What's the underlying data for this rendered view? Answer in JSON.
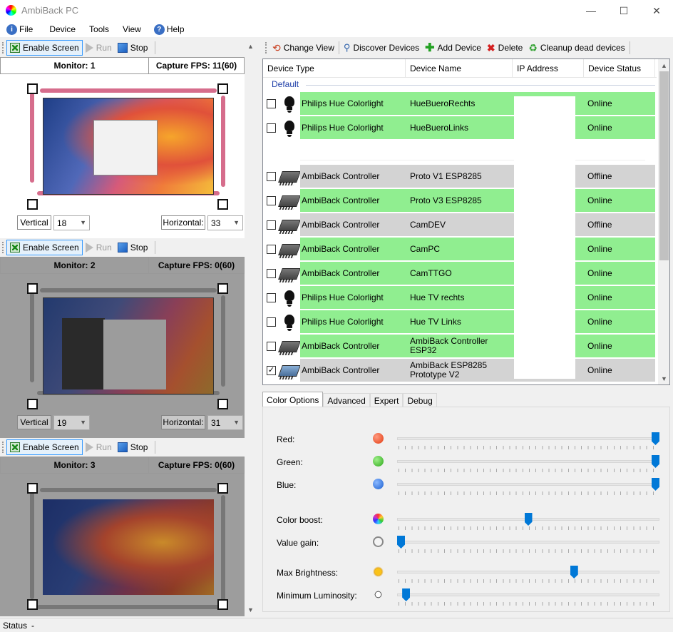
{
  "window": {
    "title": "AmbiBack PC",
    "controls": {
      "minimize": "—",
      "maximize": "☐",
      "close": "✕"
    }
  },
  "menu": [
    "File",
    "Device",
    "Tools",
    "View",
    "Help"
  ],
  "monitors": [
    {
      "toolbar": {
        "enable": "Enable Screen",
        "run": "Run",
        "stop": "Stop"
      },
      "name": "Monitor: 1",
      "fps": "Capture FPS: 11(60)",
      "vertical_label": "Vertical",
      "vertical_value": "18",
      "horizontal_label": "Horizontal:",
      "horizontal_value": "33",
      "active": true
    },
    {
      "toolbar": {
        "enable": "Enable Screen",
        "run": "Run",
        "stop": "Stop"
      },
      "name": "Monitor: 2",
      "fps": "Capture FPS: 0(60)",
      "vertical_label": "Vertical",
      "vertical_value": "19",
      "horizontal_label": "Horizontal:",
      "horizontal_value": "31",
      "active": false
    },
    {
      "toolbar": {
        "enable": "Enable Screen",
        "run": "Run",
        "stop": "Stop"
      },
      "name": "Monitor: 3",
      "fps": "Capture FPS: 0(60)",
      "active": false
    }
  ],
  "device_toolbar": [
    "Change View",
    "Discover Devices",
    "Add Device",
    "Delete",
    "Cleanup dead devices"
  ],
  "table": {
    "columns": [
      "Device Type",
      "Device Name",
      "IP Address",
      "Device Status"
    ],
    "group": "Default",
    "rows": [
      {
        "type": "Philips Hue Colorlight",
        "name": "HueBueroRechts",
        "status": "Online",
        "icon": "bulb-icon",
        "color": "green",
        "checked": false
      },
      {
        "type": "Philips Hue Colorlight",
        "name": "HueBueroLinks",
        "status": "Online",
        "icon": "bulb-icon",
        "color": "green",
        "checked": false
      },
      {
        "type": "",
        "name": "",
        "status": "",
        "icon": "none",
        "color": "white",
        "checked": false
      },
      {
        "type": "AmbiBack Controller",
        "name": "Proto V1 ESP8285",
        "status": "Offline",
        "icon": "controller-icon",
        "color": "grey",
        "checked": false
      },
      {
        "type": "AmbiBack Controller",
        "name": "Proto V3 ESP8285",
        "status": "Online",
        "icon": "controller-icon",
        "color": "green",
        "checked": false
      },
      {
        "type": "AmbiBack Controller",
        "name": "CamDEV",
        "status": "Offline",
        "icon": "controller-icon",
        "color": "grey",
        "checked": false
      },
      {
        "type": "AmbiBack Controller",
        "name": "CamPC",
        "status": "Online",
        "icon": "controller-icon",
        "color": "green",
        "checked": false
      },
      {
        "type": "AmbiBack Controller",
        "name": "CamTTGO",
        "status": "Online",
        "icon": "controller-icon",
        "color": "green",
        "checked": false
      },
      {
        "type": "Philips Hue Colorlight",
        "name": "Hue TV rechts",
        "status": "Online",
        "icon": "bulb-icon",
        "color": "green",
        "checked": false
      },
      {
        "type": "Philips Hue Colorlight",
        "name": "Hue TV Links",
        "status": "Online",
        "icon": "bulb-icon",
        "color": "green",
        "checked": false
      },
      {
        "type": "AmbiBack Controller",
        "name": "AmbiBack Controller ESP32",
        "status": "Online",
        "icon": "controller-icon",
        "color": "green",
        "checked": false
      },
      {
        "type": "AmbiBack Controller",
        "name": "AmbiBack ESP8285 Prototype V2",
        "status": "Online",
        "icon": "controller-blue-icon",
        "color": "grey",
        "checked": true
      }
    ]
  },
  "tabs": [
    "Color Options",
    "Advanced",
    "Expert",
    "Debug"
  ],
  "sliders": [
    {
      "label": "Red:",
      "icon": "red-dot-icon",
      "value": 1.0
    },
    {
      "label": "Green:",
      "icon": "green-dot-icon",
      "value": 1.0
    },
    {
      "label": "Blue:",
      "icon": "blue-dot-icon",
      "value": 1.0
    },
    {
      "label": "Color boost:",
      "icon": "color-wheel-icon",
      "value": 0.5
    },
    {
      "label": "Value gain:",
      "icon": "gain-icon",
      "value": 0.0
    },
    {
      "label": "Max Brightness:",
      "icon": "sun-icon",
      "value": 0.68
    },
    {
      "label": "Minimum Luminosity:",
      "icon": "sun-outline-icon",
      "value": 0.02
    }
  ],
  "status": {
    "label": "Status",
    "value": "-"
  },
  "colors": {
    "online": "#90ee90",
    "offline": "#d3d3d3",
    "accent": "#0078d7",
    "led_arrow": "#d66d8c"
  }
}
